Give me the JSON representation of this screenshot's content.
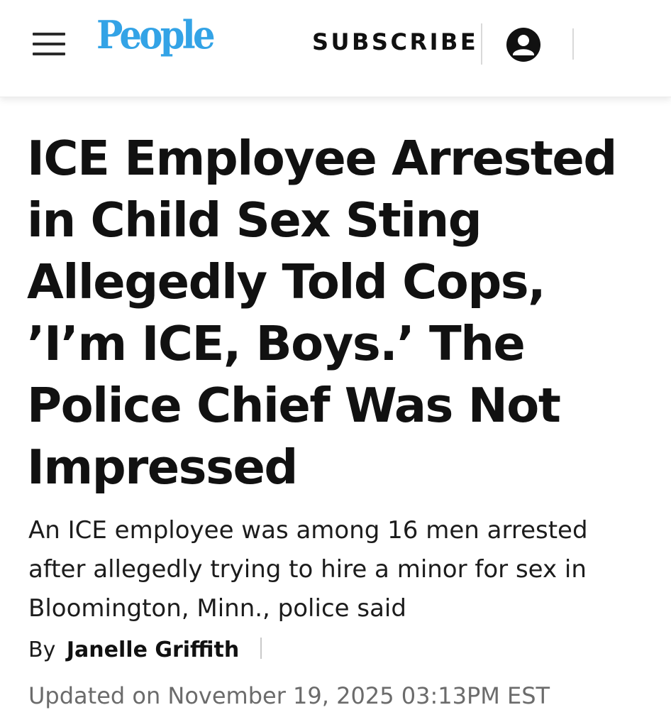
{
  "header": {
    "menu_icon": "hamburger-menu-icon",
    "logo_text": "People",
    "subscribe_label": "SUBSCRIBE",
    "account_icon": "user-account-icon",
    "colors": {
      "logo": "#33a3e6",
      "text": "#111111",
      "divider": "#d9d9d9"
    }
  },
  "article": {
    "headline": "ICE Employee Arrested in Child Sex Sting Allegedly Told Cops, ’I’m ICE, Boys.’ The Police Chief Was Not Impressed",
    "dek": "An ICE employee was among 16 men arrested after allegedly trying to hire a minor for sex in Bloomington, Minn., police said",
    "byline_prefix": "By",
    "author": "Janelle Griffith",
    "updated": "Updated on November 19, 2025 03:13PM EST",
    "colors": {
      "updated_text": "#6b6b6b"
    }
  }
}
